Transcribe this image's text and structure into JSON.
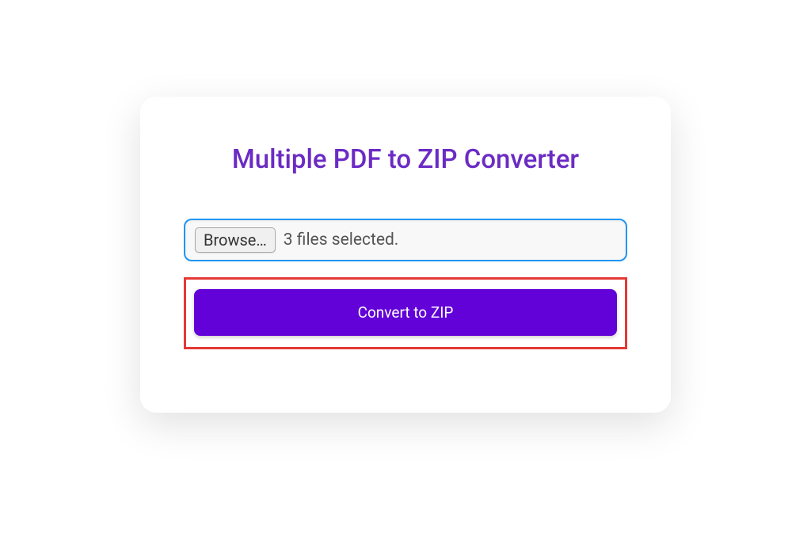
{
  "title": "Multiple PDF to ZIP Converter",
  "fileInput": {
    "browseLabel": "Browse…",
    "status": "3 files selected."
  },
  "convertButton": {
    "label": "Convert to ZIP"
  }
}
